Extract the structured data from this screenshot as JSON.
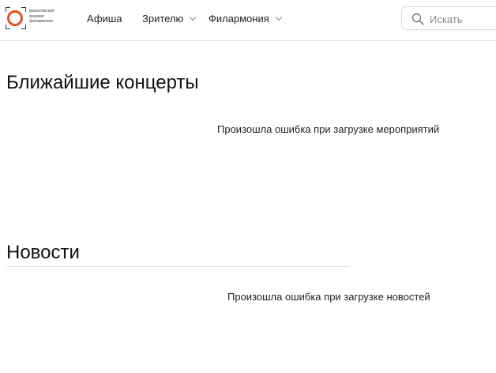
{
  "header": {
    "logo": {
      "lines": [
        "красноярская",
        "краевая",
        "филармония"
      ],
      "accent_color": "#e8501f"
    },
    "nav": [
      {
        "label": "Афиша",
        "has_dropdown": false
      },
      {
        "label": "Зрителю",
        "has_dropdown": true
      },
      {
        "label": "Филармония",
        "has_dropdown": true
      }
    ],
    "search": {
      "placeholder": "Искать",
      "value": "",
      "icon": "search-icon"
    }
  },
  "concerts": {
    "title": "Ближайшие концерты",
    "error": "Произошла ошибка при загрузке мероприятий"
  },
  "news": {
    "title": "Новости",
    "error": "Произошла ошибка при загрузке новостей"
  }
}
